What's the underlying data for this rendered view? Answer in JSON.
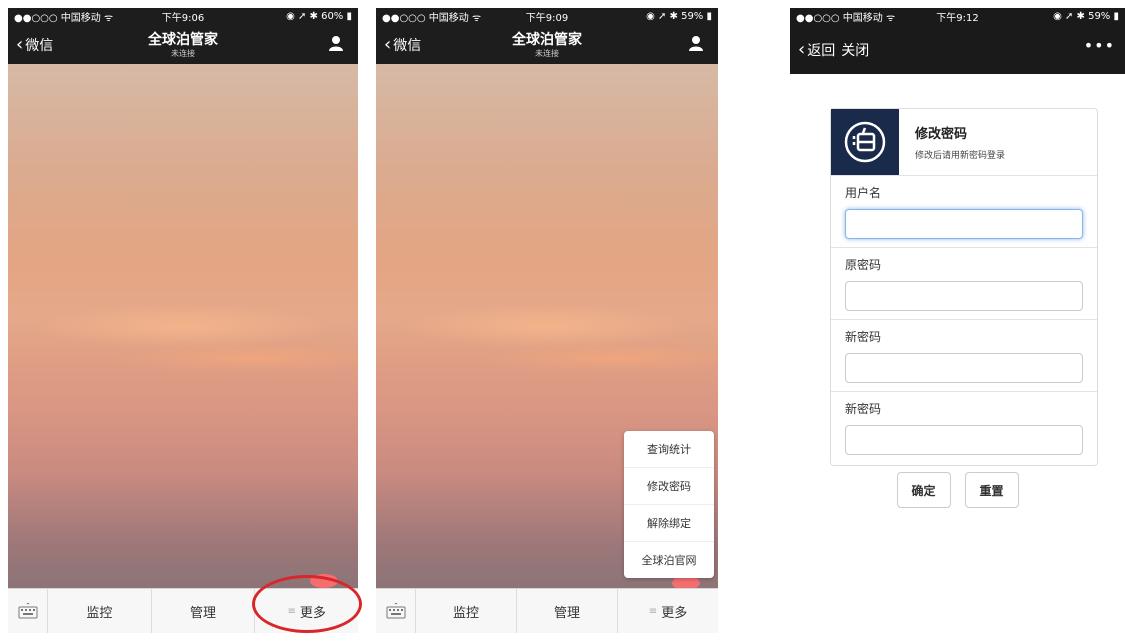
{
  "screen1": {
    "status": {
      "carrier": "●●○○○ 中国移动 ᯤ",
      "time": "下午9:06",
      "right": "◉ ➚ ✱ 60% ▮"
    },
    "nav": {
      "back": "微信",
      "title": "全球泊管家",
      "subtitle": "未连接"
    },
    "tabs": [
      "监控",
      "管理",
      "更多"
    ]
  },
  "screen2": {
    "status": {
      "carrier": "●●○○○ 中国移动 ᯤ",
      "time": "下午9:09",
      "right": "◉ ➚ ✱ 59% ▮"
    },
    "nav": {
      "back": "微信",
      "title": "全球泊管家",
      "subtitle": "未连接"
    },
    "tabs": [
      "监控",
      "管理",
      "更多"
    ],
    "menu": [
      "查询统计",
      "修改密码",
      "解除绑定",
      "全球泊官网"
    ]
  },
  "screen3": {
    "status": {
      "carrier": "●●○○○ 中国移动 ᯤ",
      "time": "下午9:12",
      "right": "◉ ➚ ✱ 59% ▮"
    },
    "nav": {
      "back": "返回",
      "close": "关闭",
      "more": "•••"
    },
    "form": {
      "title": "修改密码",
      "subtitle": "修改后请用新密码登录",
      "fields": [
        {
          "label": "用户名",
          "value": ""
        },
        {
          "label": "原密码",
          "value": ""
        },
        {
          "label": "新密码",
          "value": ""
        },
        {
          "label": "新密码",
          "value": ""
        }
      ],
      "confirm": "确定",
      "reset": "重置"
    }
  },
  "colors": {
    "navbar": "#1d1d1d",
    "annotation": "#d9262c",
    "logo_bg": "#1a2a4a",
    "focus_glow": "#66a0e9"
  }
}
